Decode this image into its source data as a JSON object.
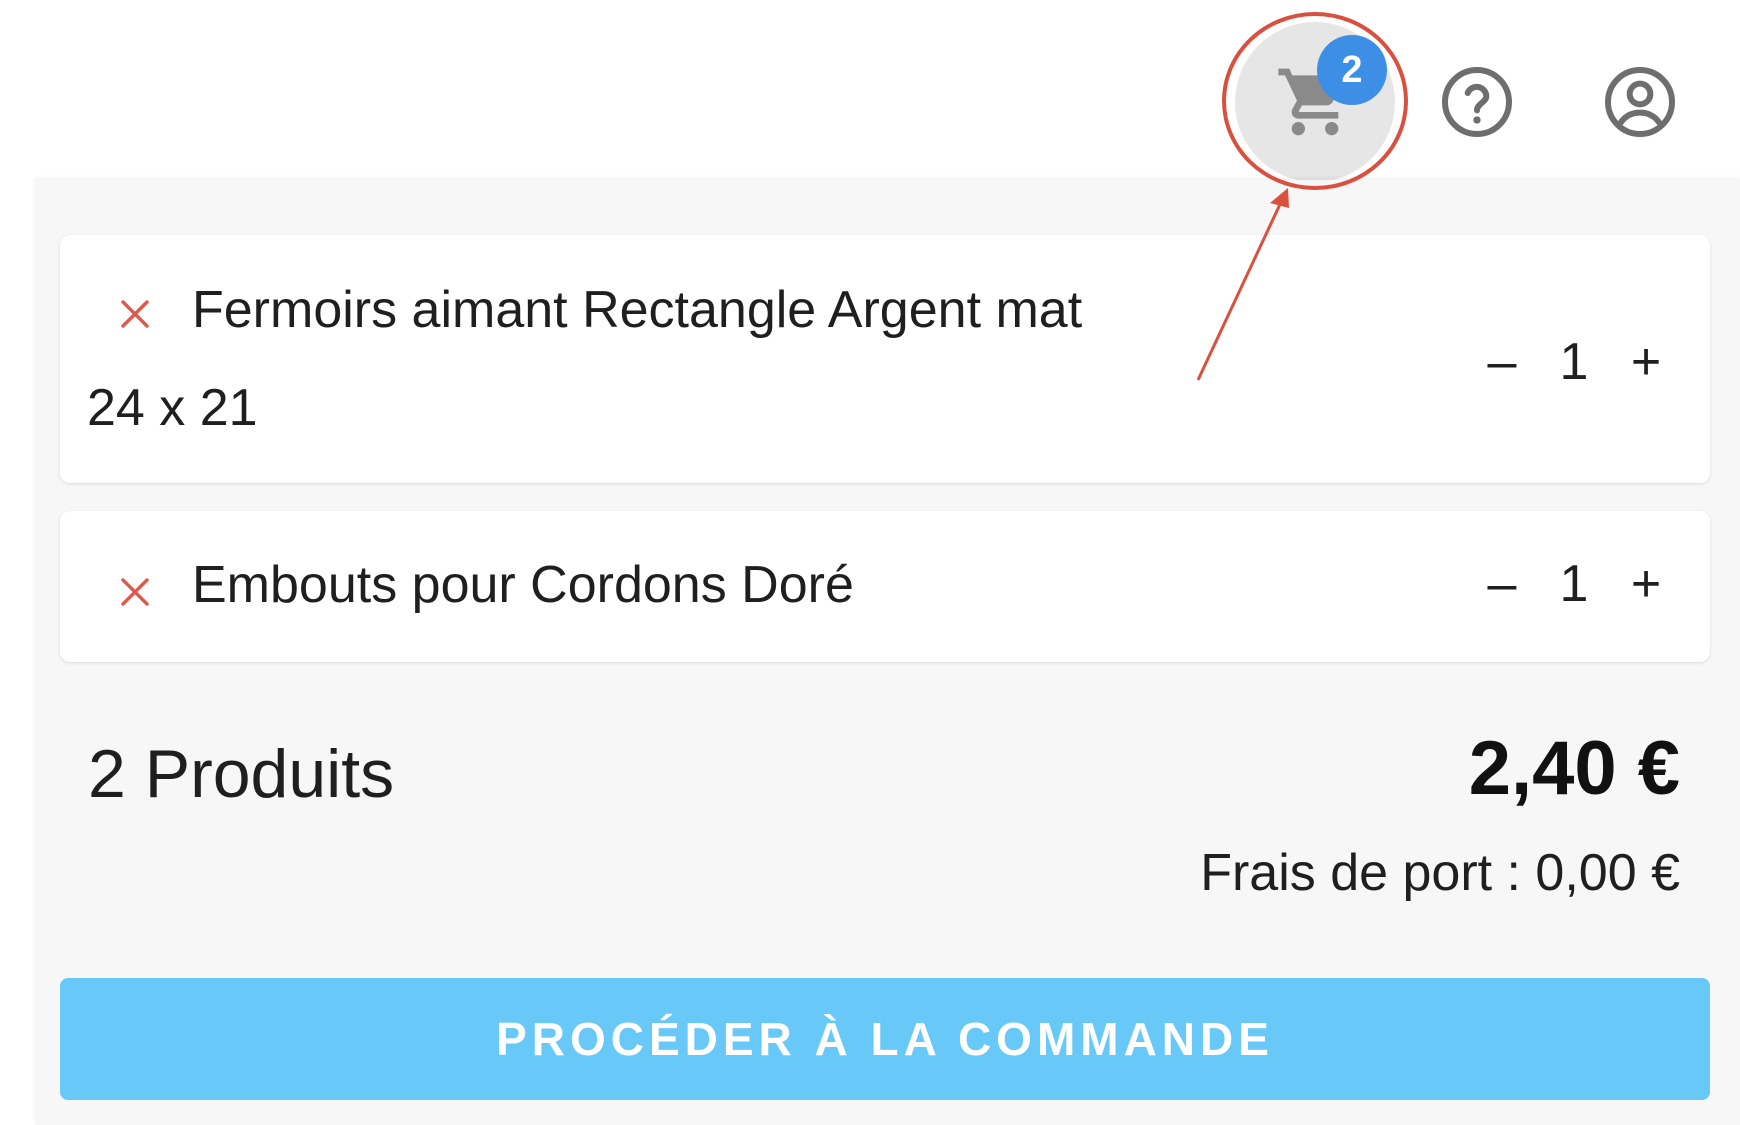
{
  "header": {
    "cart": {
      "badge_count": "2",
      "icon": "cart-icon"
    },
    "help": {
      "icon": "help-circle-icon"
    },
    "account": {
      "icon": "account-circle-icon"
    }
  },
  "cart": {
    "items": [
      {
        "name": "Fermoirs aimant Rectangle Argent mat",
        "variant": "24 x 21",
        "quantity": "1",
        "decrement": "–",
        "increment": "+"
      },
      {
        "name": "Embouts pour Cordons Doré",
        "quantity": "1",
        "decrement": "–",
        "increment": "+"
      }
    ],
    "summary": {
      "count_label": "2 Produits",
      "total": "2,40 €",
      "shipping": "Frais de port : 0,00 €"
    },
    "checkout_label": "PROCÉDER À LA COMMANDE"
  },
  "colors": {
    "badge": "#3d8fe6",
    "remove_icon": "#e2574c",
    "checkout_button": "#68c9f9",
    "annotation": "#d9503f"
  }
}
